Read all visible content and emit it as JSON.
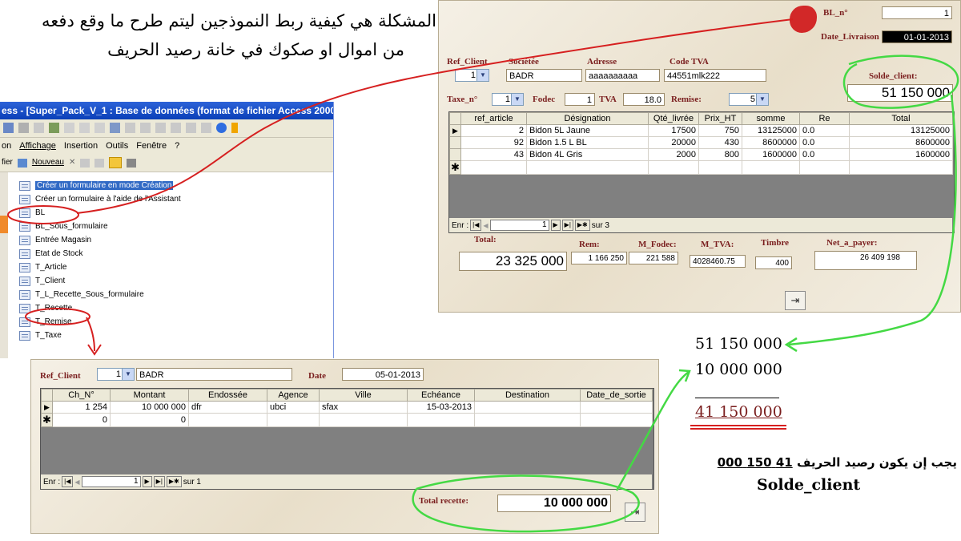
{
  "annotation": {
    "title_line1": "المشكلة هي كيفية ربط النموذجين ليتم طرح ما وقع دفعه",
    "title_line2": "من اموال او صكوك في خانة  رصيد الحريف",
    "calc_line1": "51 150 000",
    "calc_line2": "10 000 000",
    "calc_result": "41 150 000",
    "conclusion_text": "يجب إن يكون رصيد الحريف",
    "conclusion_value": "41 150 000",
    "conclusion_field": "Solde_client",
    "colors": {
      "circle": "#44d944",
      "arrow_red": "#d62020"
    }
  },
  "access_window": {
    "title": "ess - [Super_Pack_V_1 : Base de données (format de fichier Access 2000)]",
    "menu": [
      "on",
      "Affichage",
      "Insertion",
      "Outils",
      "Fenêtre",
      "?"
    ],
    "toolbar": {
      "file_label": "fier",
      "new_label": "Nouveau"
    },
    "items": [
      {
        "icon": "form-design-icon",
        "label": "Créer un formulaire en mode Création"
      },
      {
        "icon": "form-wizard-icon",
        "label": "Créer un formulaire à l'aide de l'Assistant"
      },
      {
        "icon": "form-icon",
        "label": "BL"
      },
      {
        "icon": "form-icon",
        "label": "BL_Sous_formulaire"
      },
      {
        "icon": "form-icon",
        "label": "Entrée Magasin"
      },
      {
        "icon": "form-icon",
        "label": "Etat de Stock"
      },
      {
        "icon": "form-icon",
        "label": "T_Article"
      },
      {
        "icon": "form-icon",
        "label": "T_Client"
      },
      {
        "icon": "form-icon",
        "label": "T_L_Recette_Sous_formulaire"
      },
      {
        "icon": "form-icon",
        "label": "T_Recette"
      },
      {
        "icon": "form-icon",
        "label": "T_Remise"
      },
      {
        "icon": "form-icon",
        "label": "T_Taxe"
      }
    ]
  },
  "bl_form": {
    "bl_n_label": "BL_n°",
    "bl_n_value": "1",
    "date_livraison_label": "Date_Livraison",
    "date_livraison_value": "01-01-2013",
    "ref_client_label": "Ref_Client",
    "ref_client_value": "1",
    "societe_label": "Sociétée",
    "societe_value": "BADR",
    "adresse_label": "Adresse",
    "adresse_value": "aaaaaaaaaa",
    "code_tva_label": "Code TVA",
    "code_tva_value": "44551mlk222",
    "solde_client_label": "Solde_client:",
    "solde_client_value": "51 150 000",
    "taxe_label": "Taxe_n°",
    "taxe_value": "1",
    "fodec_label": "Fodec",
    "fodec_value": "1",
    "tva_label": "TVA",
    "tva_value": "18.0",
    "remise_label": "Remise:",
    "remise_value": "5",
    "columns": [
      "ref_article",
      "Désignation",
      "Qté_livrée",
      "Prix_HT",
      "somme",
      "Re",
      "Total"
    ],
    "rows": [
      [
        "2",
        "Bidon 5L Jaune",
        "17500",
        "750",
        "13125000",
        "0.0",
        "13125000"
      ],
      [
        "92",
        "Bidon 1.5 L BL",
        "20000",
        "430",
        "8600000",
        "0.0",
        "8600000"
      ],
      [
        "43",
        "Bidon 4L Gris",
        "2000",
        "800",
        "1600000",
        "0.0",
        "1600000"
      ]
    ],
    "nav": {
      "label": "Enr :",
      "current": "1",
      "total_text": "sur 3"
    },
    "total_label": "Total:",
    "total_value": "23 325 000",
    "rem_label": "Rem:",
    "rem_value": "1 166 250",
    "m_fodec_label": "M_Fodec:",
    "m_fodec_value": "221 588",
    "m_tva_label": "M_TVA:",
    "m_tva_value": "4028460.75",
    "timbre_label": "Timbre",
    "timbre_value": "400",
    "net_label": "Net_a_payer:",
    "net_value": "26 409 198"
  },
  "recette_form": {
    "ref_client_label": "Ref_Client",
    "ref_client_value": "1",
    "client_name": "BADR",
    "date_label": "Date",
    "date_value": "05-01-2013",
    "columns": [
      "Ch_N°",
      "Montant",
      "Endossée",
      "Agence",
      "Ville",
      "Echéance",
      "Destination",
      "Date_de_sortie"
    ],
    "rows": [
      [
        "1 254",
        "10 000 000",
        "dfr",
        "ubci",
        "sfax",
        "15-03-2013",
        "",
        ""
      ],
      [
        "0",
        "0",
        "",
        "",
        "",
        "",
        "",
        ""
      ]
    ],
    "nav": {
      "label": "Enr :",
      "current": "1",
      "total_text": "sur 1"
    },
    "total_label": "Total recette:",
    "total_value": "10 000 000"
  }
}
